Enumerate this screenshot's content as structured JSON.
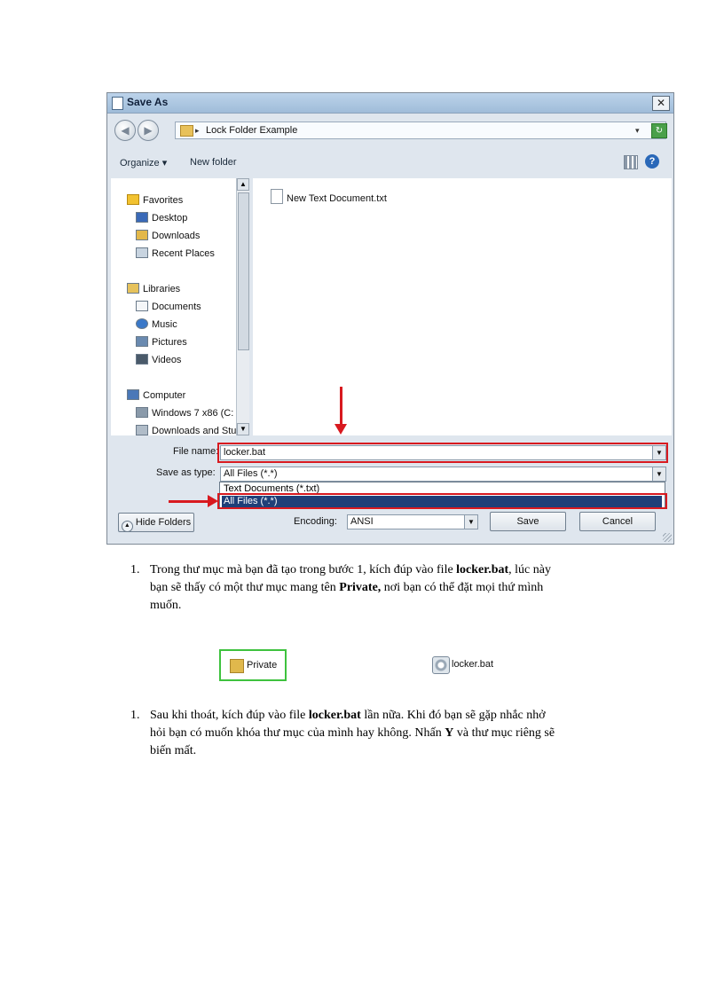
{
  "dialog": {
    "title": "Save As",
    "close_label": "✕",
    "address": {
      "path": "Lock Folder Example",
      "chevron": "▸",
      "dropdown": "▾"
    },
    "toolbar": {
      "organize": "Organize ▾",
      "new_folder": "New folder",
      "help": "?"
    },
    "nav": {
      "favorites": "Favorites",
      "desktop": "Desktop",
      "downloads": "Downloads",
      "recent_places": "Recent Places",
      "libraries": "Libraries",
      "documents": "Documents",
      "music": "Music",
      "pictures": "Pictures",
      "videos": "Videos",
      "computer": "Computer",
      "windows_drive": "Windows 7 x86 (C:",
      "downloads_and": "Downloads and Stu"
    },
    "files": [
      {
        "name": "New Text Document.txt"
      }
    ],
    "form": {
      "file_name_label": "File name:",
      "file_name_value": "locker.bat",
      "save_type_label": "Save as type:",
      "save_type_value": "All Files  (*.*)",
      "options": [
        "Text Documents (*.txt)",
        "All Files  (*.*)"
      ],
      "encoding_label": "Encoding:",
      "encoding_value": "ANSI"
    },
    "buttons": {
      "hide_folders": "Hide Folders",
      "save": "Save",
      "cancel": "Cancel"
    },
    "highlight_color": "#d8191f"
  },
  "steps": [
    {
      "number": "1.",
      "line1_a": "Trong thư mục mà bạn đã tạo trong bước 1, kích đúp vào file ",
      "line1_b": "locker.bat",
      "line1_c": ", lúc này",
      "line2_a": "bạn sẽ thấy có một thư mục mang tên ",
      "line2_b": "Private,",
      "line2_c": " nơi bạn có thể đặt mọi thứ mình",
      "line3": "muốn."
    },
    {
      "number": "1.",
      "line1_a": "Sau khi thoát, kích đúp vào file ",
      "line1_b": "locker.bat",
      "line1_c": " lần nữa. Khi đó bạn sẽ gặp nhắc nhở",
      "line2_a": "hỏi bạn có muốn khóa thư mục của mình hay không. Nhấn ",
      "line2_b": "Y",
      "line2_c": " và thư mục riêng sẽ",
      "line3": "biến mất."
    }
  ],
  "icons": {
    "private_folder": "Private",
    "locker_file": "locker.bat",
    "private_box_color": "#3ec23e"
  }
}
